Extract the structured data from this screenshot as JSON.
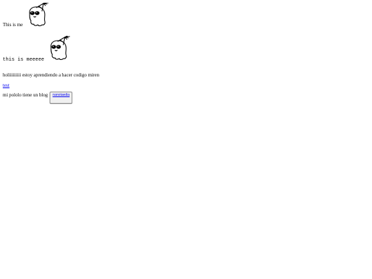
{
  "intro": {
    "label": "This is me",
    "image_icon": "ghost-party-hat-icon"
  },
  "intro_mono": {
    "label": "this is meeeee",
    "image_icon": "ghost-party-hat-icon"
  },
  "paragraph": {
    "text": "holiiiiiiiii estoy aprendiendo a hacer codigo miren"
  },
  "link": {
    "text": "test"
  },
  "blog": {
    "text": "mi pololo tiene un blog",
    "button_link": "nanotaedia"
  }
}
